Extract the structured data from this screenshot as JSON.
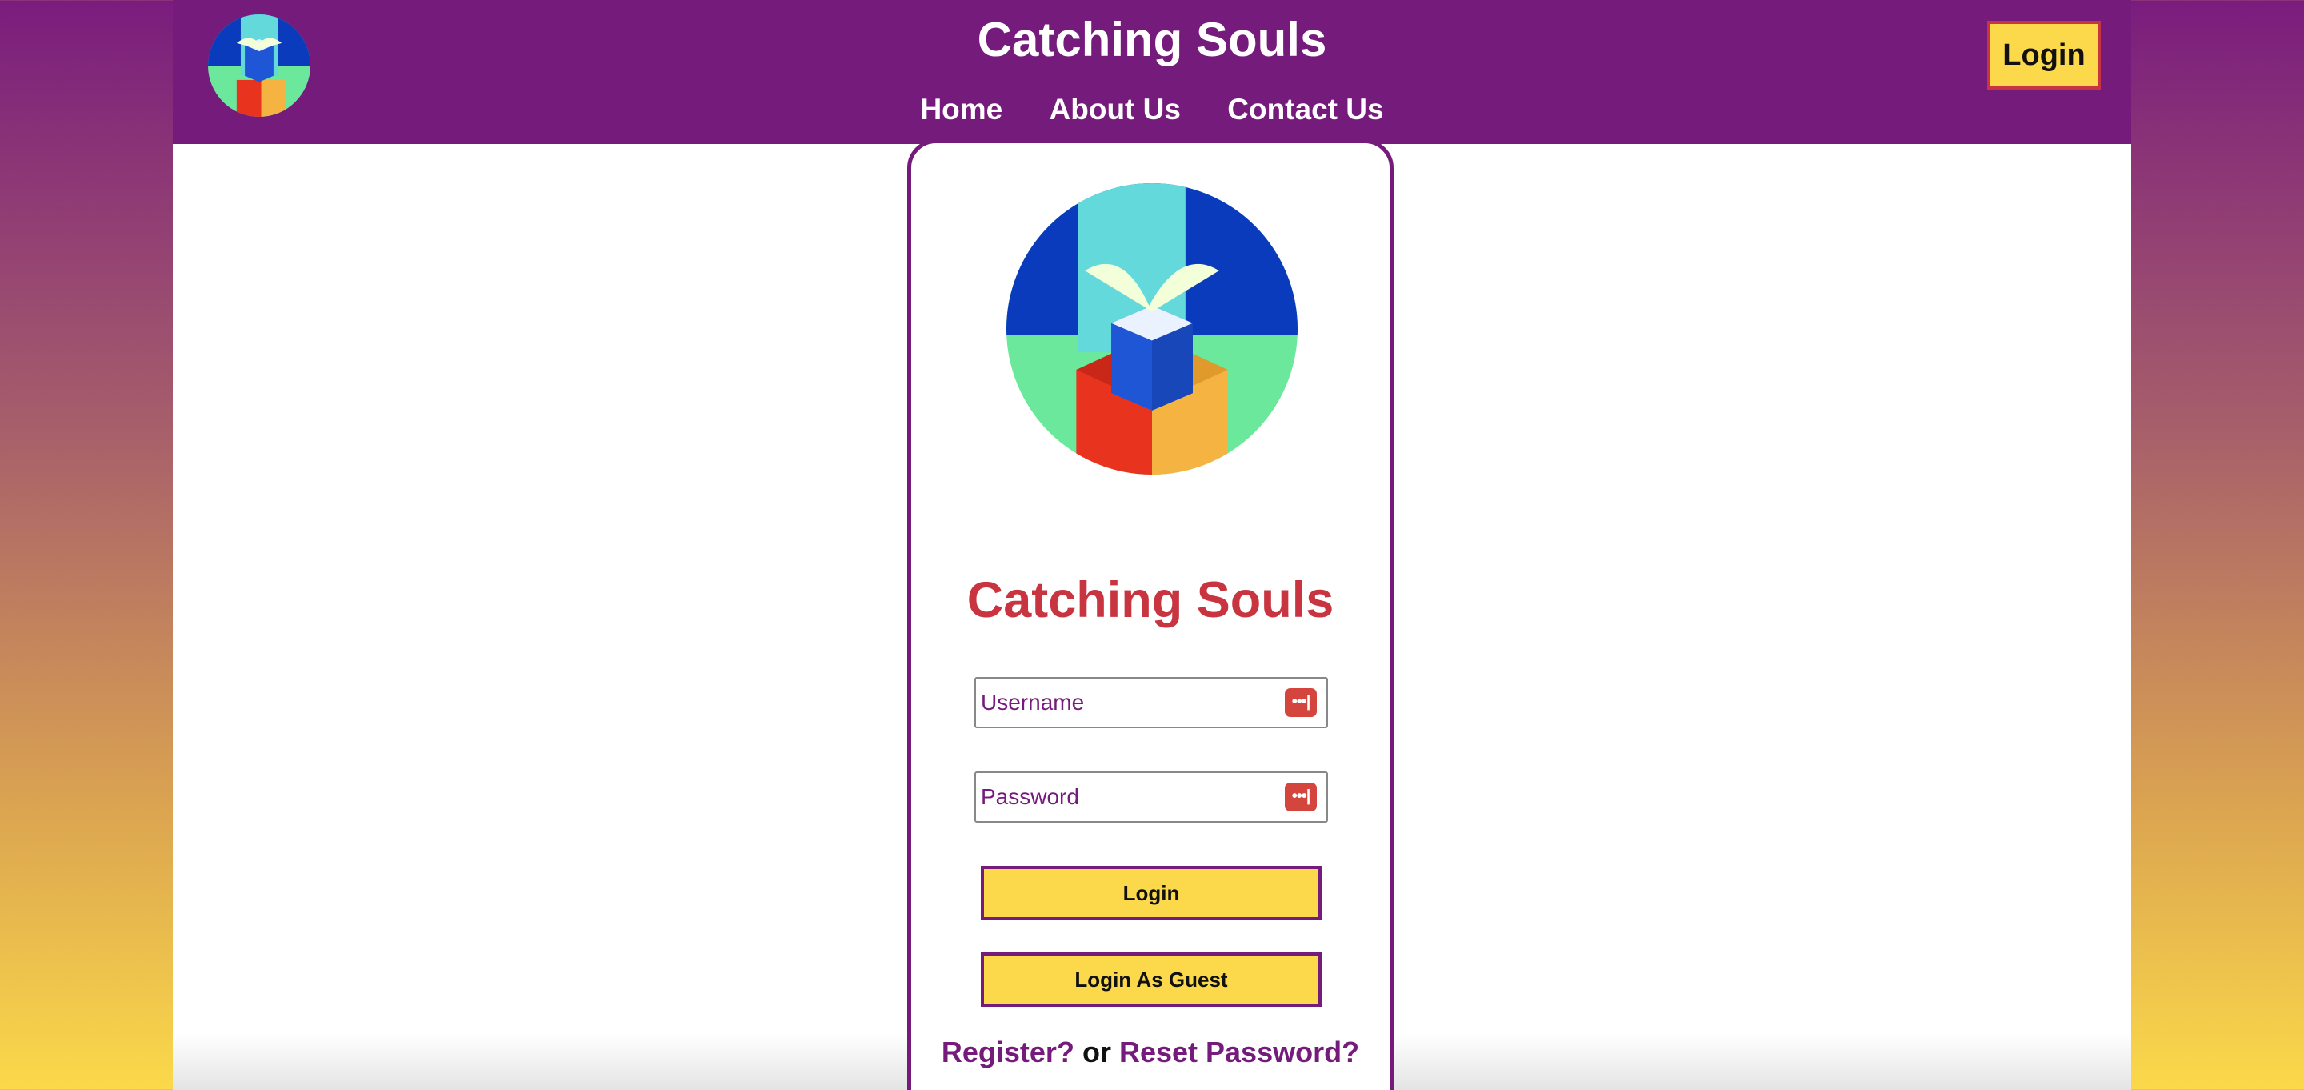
{
  "header": {
    "title": "Catching Souls",
    "logo_icon": "catching-souls-logo-icon",
    "login_label": "Login",
    "nav": [
      {
        "label": "Home"
      },
      {
        "label": "About Us"
      },
      {
        "label": "Contact Us"
      }
    ]
  },
  "card": {
    "logo_icon": "catching-souls-logo-icon",
    "title": "Catching Souls",
    "username": {
      "placeholder": "Username",
      "value": "",
      "icon": "password-manager-key-icon"
    },
    "password": {
      "placeholder": "Password",
      "value": "",
      "icon": "password-manager-key-icon"
    },
    "login_button": "Login",
    "guest_button": "Login As Guest",
    "register_link": "Register?",
    "or_text": "or",
    "reset_link": "Reset Password?"
  },
  "colors": {
    "brand_purple": "#751b7b",
    "accent_yellow": "#fcd94b",
    "accent_red": "#c8343f"
  }
}
